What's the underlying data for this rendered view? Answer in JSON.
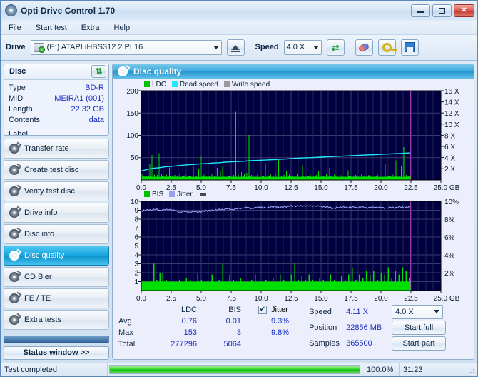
{
  "window": {
    "title": "Opti Drive Control 1.70",
    "icon": "disc-icon",
    "buttons": {
      "minimize": "minimize-icon",
      "maximize": "maximize-icon",
      "close": "✕"
    }
  },
  "menu": {
    "items": [
      "File",
      "Start test",
      "Extra",
      "Help"
    ]
  },
  "toolbar": {
    "drive_label": "Drive",
    "drive_value": "(E:)  ATAPI iHBS312  2 PL16",
    "eject": "eject-icon",
    "speed_label": "Speed",
    "speed_value": "4.0 X",
    "refresh": "refresh-icon",
    "icons": [
      "eraser-icon",
      "key-icon",
      "save-icon"
    ]
  },
  "disc": {
    "header": "Disc",
    "refresh": "refresh-icon",
    "rows": [
      {
        "key": "Type",
        "value": "BD-R"
      },
      {
        "key": "MID",
        "value": "MEIRA1 (001)"
      },
      {
        "key": "Length",
        "value": "22.32 GB"
      },
      {
        "key": "Contents",
        "value": "data"
      }
    ],
    "label_key": "Label",
    "label_value": "",
    "label_placeholder": ""
  },
  "nav": {
    "items": [
      {
        "label": "Transfer rate",
        "active": false
      },
      {
        "label": "Create test disc",
        "active": false
      },
      {
        "label": "Verify test disc",
        "active": false
      },
      {
        "label": "Drive info",
        "active": false
      },
      {
        "label": "Disc info",
        "active": false
      },
      {
        "label": "Disc quality",
        "active": true
      },
      {
        "label": "CD Bler",
        "active": false
      },
      {
        "label": "FE / TE",
        "active": false
      },
      {
        "label": "Extra tests",
        "active": false
      }
    ],
    "status_button": "Status window >>"
  },
  "panel": {
    "title": "Disc quality",
    "icon": "disc-quality-icon"
  },
  "stats": {
    "columns": [
      "LDC",
      "BIS"
    ],
    "rows": [
      {
        "label": "Avg",
        "ldc": "0.76",
        "bis": "0.01"
      },
      {
        "label": "Max",
        "ldc": "153",
        "bis": "3"
      },
      {
        "label": "Total",
        "ldc": "277296",
        "bis": "5064"
      }
    ],
    "jitter": {
      "checkbox_checked": true,
      "label": "Jitter",
      "avg": "9.3%",
      "max": "9.8%"
    },
    "right": [
      {
        "label": "Speed",
        "value": "4.11 X"
      },
      {
        "label": "Position",
        "value": "22856 MB"
      },
      {
        "label": "Samples",
        "value": "365500"
      }
    ],
    "speed_select": "4.0 X",
    "start_full": "Start full",
    "start_part": "Start part"
  },
  "statusbar": {
    "message": "Test completed",
    "progress_pct": "100.0%",
    "progress_value": 100,
    "elapsed": "31:23"
  },
  "colors": {
    "plot_bg": "#000040",
    "grid": "#3a3a6e",
    "ldc": "#00e000",
    "read_speed": "#20e8f8",
    "write_speed": "#9a9a9a",
    "bis": "#00e000",
    "jitter": "#9aa0f0",
    "marker": "#e040e0",
    "value_text": "#1b2ec4",
    "accent": "#2496d0"
  },
  "chart_data": [
    {
      "type": "area",
      "id": "quality-top",
      "title": "",
      "xlabel": "GB",
      "ylabel": "",
      "xlim": [
        0,
        25.0
      ],
      "ylim": [
        0,
        200
      ],
      "y2lim": [
        0,
        16
      ],
      "y2label": "X",
      "grid": true,
      "legend": [
        "LDC",
        "Read speed",
        "Write speed"
      ],
      "legend_position": "top-left",
      "xticks": [
        "0.0",
        "2.5",
        "5.0",
        "7.5",
        "10.0",
        "12.5",
        "15.0",
        "17.5",
        "20.0",
        "22.5",
        "25.0 GB"
      ],
      "yticks": [
        "200",
        "150",
        "100",
        "50"
      ],
      "y2ticks": [
        "16 X",
        "14 X",
        "12 X",
        "10 X",
        "8 X",
        "6 X",
        "4 X",
        "2 X"
      ],
      "data_end_gb": 22.5,
      "series": [
        {
          "name": "LDC",
          "color": "#00e000",
          "kind": "spikes",
          "baseline": 6,
          "x": [
            0.05,
            0.25,
            0.45,
            0.7,
            0.9,
            1.1,
            1.35,
            1.5,
            1.7,
            1.9,
            2.1,
            2.35,
            2.6,
            2.8,
            3.0,
            3.2,
            3.45,
            3.7,
            3.9,
            4.1,
            4.35,
            4.6,
            4.8,
            5.0,
            5.25,
            5.45,
            5.7,
            5.9,
            6.1,
            6.35,
            6.6,
            6.8,
            7.0,
            7.2,
            7.45,
            7.7,
            7.9,
            8.1,
            8.35,
            8.6,
            8.8,
            9.0,
            9.2,
            9.45,
            9.7,
            9.9,
            10.1,
            10.35,
            10.6,
            10.8,
            11.0,
            11.2,
            11.45,
            11.7,
            11.9,
            12.1,
            12.35,
            12.6,
            12.8,
            13.0,
            13.25,
            13.45,
            13.7,
            13.9,
            14.1,
            14.35,
            14.6,
            14.8,
            15.0,
            15.25,
            15.45,
            15.7,
            15.9,
            16.1,
            16.35,
            16.6,
            16.8,
            17.0,
            17.25,
            17.45,
            17.7,
            17.9,
            18.1,
            18.35,
            18.6,
            18.8,
            19.0,
            19.25,
            19.5,
            19.7,
            19.9,
            20.1,
            20.35,
            20.6,
            20.8,
            21.0,
            21.25,
            21.5,
            21.7,
            21.9,
            22.1,
            22.3,
            22.45
          ],
          "y": [
            14,
            10,
            9,
            35,
            56,
            12,
            11,
            60,
            14,
            9,
            12,
            28,
            9,
            11,
            10,
            14,
            9,
            12,
            10,
            9,
            33,
            8,
            24,
            52,
            12,
            9,
            10,
            13,
            9,
            27,
            21,
            30,
            13,
            10,
            9,
            11,
            153,
            12,
            18,
            13,
            16,
            101,
            11,
            9,
            14,
            13,
            10,
            38,
            9,
            12,
            10,
            14,
            45,
            9,
            11,
            21,
            12,
            9,
            10,
            13,
            11,
            33,
            9,
            10,
            12,
            9,
            11,
            19,
            10,
            9,
            13,
            27,
            10,
            12,
            9,
            11,
            10,
            14,
            22,
            9,
            10,
            11,
            9,
            12,
            10,
            9,
            11,
            62,
            10,
            13,
            9,
            11,
            37,
            10,
            9,
            12,
            44,
            10,
            32,
            74,
            11,
            9,
            8
          ]
        },
        {
          "name": "Read speed",
          "color": "#20e8f8",
          "kind": "line",
          "x": [
            0.0,
            0.5,
            1.0,
            1.5,
            2.0,
            2.5,
            3.0,
            3.5,
            4.0,
            4.5,
            5.0,
            5.5,
            6.0,
            6.5,
            7.0,
            7.5,
            8.0,
            8.5,
            9.0,
            9.5,
            10.0,
            10.5,
            11.0,
            11.5,
            12.0,
            12.5,
            13.0,
            13.5,
            14.0,
            14.5,
            15.0,
            15.5,
            16.0,
            16.5,
            17.0,
            17.5,
            18.0,
            18.5,
            19.0,
            19.5,
            20.0,
            20.5,
            21.0,
            21.5,
            22.0,
            22.45
          ],
          "y_speed_x": [
            1.6,
            1.9,
            2.1,
            2.2,
            2.35,
            2.45,
            2.55,
            2.65,
            2.75,
            2.8,
            2.9,
            2.95,
            3.05,
            3.1,
            3.2,
            3.25,
            3.3,
            3.35,
            3.45,
            3.5,
            3.55,
            3.6,
            3.65,
            3.7,
            3.75,
            3.85,
            3.9,
            3.95,
            4.0,
            4.05,
            4.1,
            4.15,
            4.2,
            4.25,
            4.3,
            4.35,
            4.4,
            4.45,
            4.5,
            4.55,
            4.6,
            4.65,
            4.7,
            4.75,
            4.8,
            4.85
          ]
        },
        {
          "name": "Write speed",
          "color": "#9a9a9a",
          "kind": "none",
          "x": [],
          "y": []
        }
      ],
      "marker_line_gb": 22.45
    },
    {
      "type": "area",
      "id": "quality-bottom",
      "title": "",
      "xlabel": "GB",
      "ylabel": "",
      "xlim": [
        0,
        25.0
      ],
      "ylim": [
        0,
        10
      ],
      "y2lim": [
        0,
        10
      ],
      "y2label": "%",
      "grid": true,
      "legend": [
        "BIS",
        "Jitter"
      ],
      "legend_position": "top-left",
      "xticks": [
        "0.0",
        "2.5",
        "5.0",
        "7.5",
        "10.0",
        "12.5",
        "15.0",
        "17.5",
        "20.0",
        "22.5",
        "25.0 GB"
      ],
      "yticks": [
        "10",
        "9",
        "8",
        "7",
        "6",
        "5",
        "4",
        "3",
        "2",
        "1"
      ],
      "y2ticks": [
        "10%",
        "8%",
        "6%",
        "4%",
        "2%"
      ],
      "data_end_gb": 22.5,
      "series": [
        {
          "name": "BIS",
          "color": "#00e000",
          "kind": "spikes",
          "baseline": 1,
          "x": [
            0.15,
            0.6,
            1.05,
            1.3,
            1.55,
            1.8,
            2.1,
            2.4,
            2.7,
            2.95,
            3.2,
            3.5,
            3.75,
            4.1,
            4.4,
            4.7,
            5.0,
            5.3,
            5.6,
            5.9,
            6.2,
            6.5,
            6.8,
            7.1,
            7.4,
            7.7,
            8.0,
            8.3,
            8.6,
            8.9,
            9.2,
            9.5,
            9.8,
            10.1,
            10.4,
            10.7,
            11.0,
            11.3,
            11.6,
            11.9,
            12.2,
            12.5,
            12.8,
            13.1,
            13.4,
            13.7,
            14.0,
            14.3,
            14.6,
            14.9,
            15.2,
            15.5,
            15.8,
            16.1,
            16.4,
            16.7,
            17.0,
            17.3,
            17.6,
            17.9,
            18.2,
            18.5,
            18.8,
            19.1,
            19.4,
            19.7,
            20.0,
            20.3,
            20.6,
            20.9,
            21.2,
            21.5,
            21.8,
            22.1,
            22.35
          ],
          "y": [
            1,
            1,
            3,
            1.2,
            2,
            2,
            1.2,
            1,
            0.7,
            0.6,
            1.2,
            1,
            1.4,
            1.2,
            1,
            2,
            1.2,
            1,
            1,
            1.8,
            1,
            1.2,
            3,
            1,
            1.8,
            1.2,
            1,
            1.4,
            1,
            1,
            1.2,
            1.8,
            1,
            1,
            1.2,
            1,
            1.4,
            1,
            1.8,
            1.2,
            1,
            1.8,
            3,
            1.2,
            1.6,
            1.2,
            1.8,
            1.2,
            1,
            1.4,
            1.2,
            1,
            1.8,
            1.2,
            1,
            1.6,
            1.2,
            1.8,
            2.6,
            1.2,
            1.8,
            1.4,
            2.2,
            1.8,
            2.2,
            1.2,
            2,
            1.8,
            2.6,
            1.4,
            2.2,
            1.8,
            2.6,
            2.2,
            1.4
          ]
        },
        {
          "name": "Jitter",
          "color": "#9aa0f0",
          "kind": "line",
          "x": [
            0.0,
            0.4,
            0.8,
            1.2,
            1.6,
            2.0,
            2.4,
            2.8,
            3.2,
            3.6,
            4.0,
            4.4,
            4.8,
            5.2,
            5.6,
            6.0,
            6.4,
            6.8,
            7.2,
            7.6,
            8.0,
            8.4,
            8.8,
            9.2,
            9.6,
            10.0,
            10.4,
            10.8,
            11.2,
            11.6,
            12.0,
            12.4,
            12.8,
            13.2,
            13.6,
            14.0,
            14.4,
            14.8,
            15.2,
            15.6,
            16.0,
            16.4,
            16.8,
            17.2,
            17.6,
            18.0,
            18.4,
            18.8,
            19.2,
            19.6,
            20.0,
            20.4,
            20.8,
            21.2,
            21.6,
            22.0,
            22.4
          ],
          "y_pct": [
            8.9,
            9.0,
            9.05,
            9.1,
            9.0,
            9.05,
            9.1,
            8.95,
            8.8,
            8.85,
            8.8,
            8.85,
            8.8,
            8.9,
            8.95,
            9.0,
            9.05,
            9.1,
            9.15,
            9.1,
            9.15,
            9.25,
            9.3,
            9.2,
            9.3,
            9.35,
            9.25,
            9.35,
            9.4,
            9.3,
            9.4,
            9.45,
            9.5,
            9.45,
            9.5,
            9.45,
            9.5,
            9.45,
            9.4,
            9.35,
            9.2,
            9.3,
            9.35,
            9.3,
            9.35,
            9.3,
            9.35,
            9.3,
            9.3,
            9.35,
            9.3,
            9.25,
            9.3,
            9.3,
            9.35,
            9.3,
            9.35
          ]
        }
      ],
      "marker_line_gb": 22.45
    }
  ]
}
